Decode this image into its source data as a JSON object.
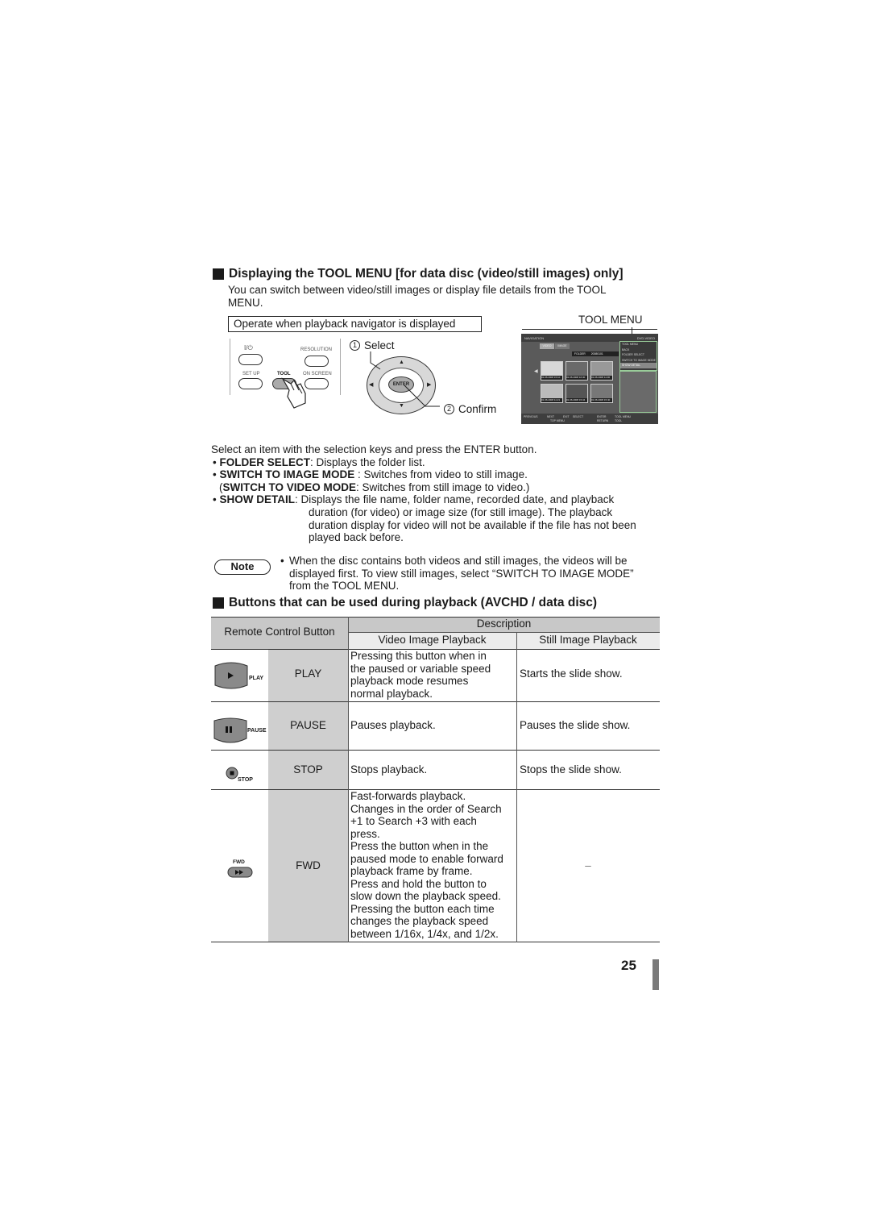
{
  "section1": {
    "title": "Displaying the TOOL MENU [for data disc (video/still images) only]",
    "intro_line1": "You can switch between video/still images or display file details from the TOOL",
    "intro_line2": "MENU.",
    "operate_box": "Operate when playback navigator is displayed",
    "tool_menu_label": "TOOL MENU",
    "step1": {
      "num": "1",
      "label": "Select"
    },
    "step2": {
      "num": "2",
      "label": "Confirm"
    },
    "remote": {
      "power": "I/⏻",
      "resolution": "RESOLUTION",
      "setup": "SET UP",
      "tool": "TOOL",
      "onscreen": "ON SCREEN",
      "enter": "ENTER"
    },
    "navigator": {
      "title": "NAVIGATION",
      "mode": "DVD-VIDEO",
      "tabs": [
        "VIDEO",
        "IMAGE"
      ],
      "folder_label": "FOLDER",
      "folder_value": "20080101",
      "thumb_captions": [
        "01.06.2008 15:10",
        "01.06.2008 16:30",
        "01.06.2008 11:00",
        "01.06.2008 11:21",
        "01.06.2008 15:34",
        "01.06.2008 15:40"
      ],
      "tool_menu_items": [
        "TOOL MENU",
        "BACK",
        "FOLDER SELECT",
        "SWITCH TO IMAGE MODE",
        "SHOW DETAIL"
      ],
      "bottom_items": [
        "PREVIOUS",
        "NEXT",
        "EXIT",
        "SELECT",
        "ENTER",
        "TOOL MENU"
      ],
      "bottom_sub": [
        "TOP MENU",
        "RETURN",
        "TOOL"
      ]
    },
    "instruction": "Select an item with the selection keys and press the ENTER button.",
    "bullets": [
      {
        "term": "FOLDER SELECT",
        "sep": ": ",
        "text": "Displays the folder list."
      },
      {
        "term": "SWITCH TO IMAGE MODE",
        "sep": " : ",
        "text": "Switches from video to still image."
      },
      {
        "term": "SHOW DETAIL",
        "sep": ": ",
        "text": "Displays the file name, folder name, recorded date, and playback"
      }
    ],
    "switch_video": {
      "open": "(",
      "term": "SWITCH TO VIDEO MODE",
      "text": ": Switches from still image to video.)"
    },
    "show_detail_cont": [
      "duration (for video) or image size (for still image). The playback",
      "duration display for video will not be available if the file has not been",
      "played back before."
    ],
    "note_label": "Note",
    "note_lines": [
      "When the disc contains both videos and still images, the videos will be",
      "displayed first. To view still images, select “SWITCH TO IMAGE MODE”",
      "from the TOOL MENU."
    ]
  },
  "section2": {
    "title": "Buttons that can be used during playback (AVCHD / data disc)",
    "table": {
      "header_button": "Remote Control Button",
      "header_description": "Description",
      "header_video": "Video Image Playback",
      "header_still": "Still Image Playback",
      "rows": [
        {
          "icon_label": "PLAY",
          "name": "PLAY",
          "video": [
            "Pressing this button when in",
            "the paused or variable speed",
            "playback mode resumes",
            "normal playback."
          ],
          "still": "Starts the slide show."
        },
        {
          "icon_label": "PAUSE",
          "name": "PAUSE",
          "video": [
            "Pauses playback."
          ],
          "still": "Pauses the slide show."
        },
        {
          "icon_label": "STOP",
          "name": "STOP",
          "video": [
            "Stops playback."
          ],
          "still": "Stops the slide show."
        },
        {
          "icon_label": "FWD",
          "name": "FWD",
          "video": [
            "Fast-forwards playback.",
            "Changes in the order of Search",
            "+1 to Search +3 with each",
            "press.",
            "Press the button when in the",
            "paused mode to enable forward",
            "playback frame by frame.",
            "Press and hold the button to",
            "slow down the playback speed.",
            "Pressing the button each time",
            "changes the playback speed",
            "between 1/16x, 1/4x, and 1/2x."
          ],
          "still": "–"
        }
      ]
    }
  },
  "page_number": "25"
}
